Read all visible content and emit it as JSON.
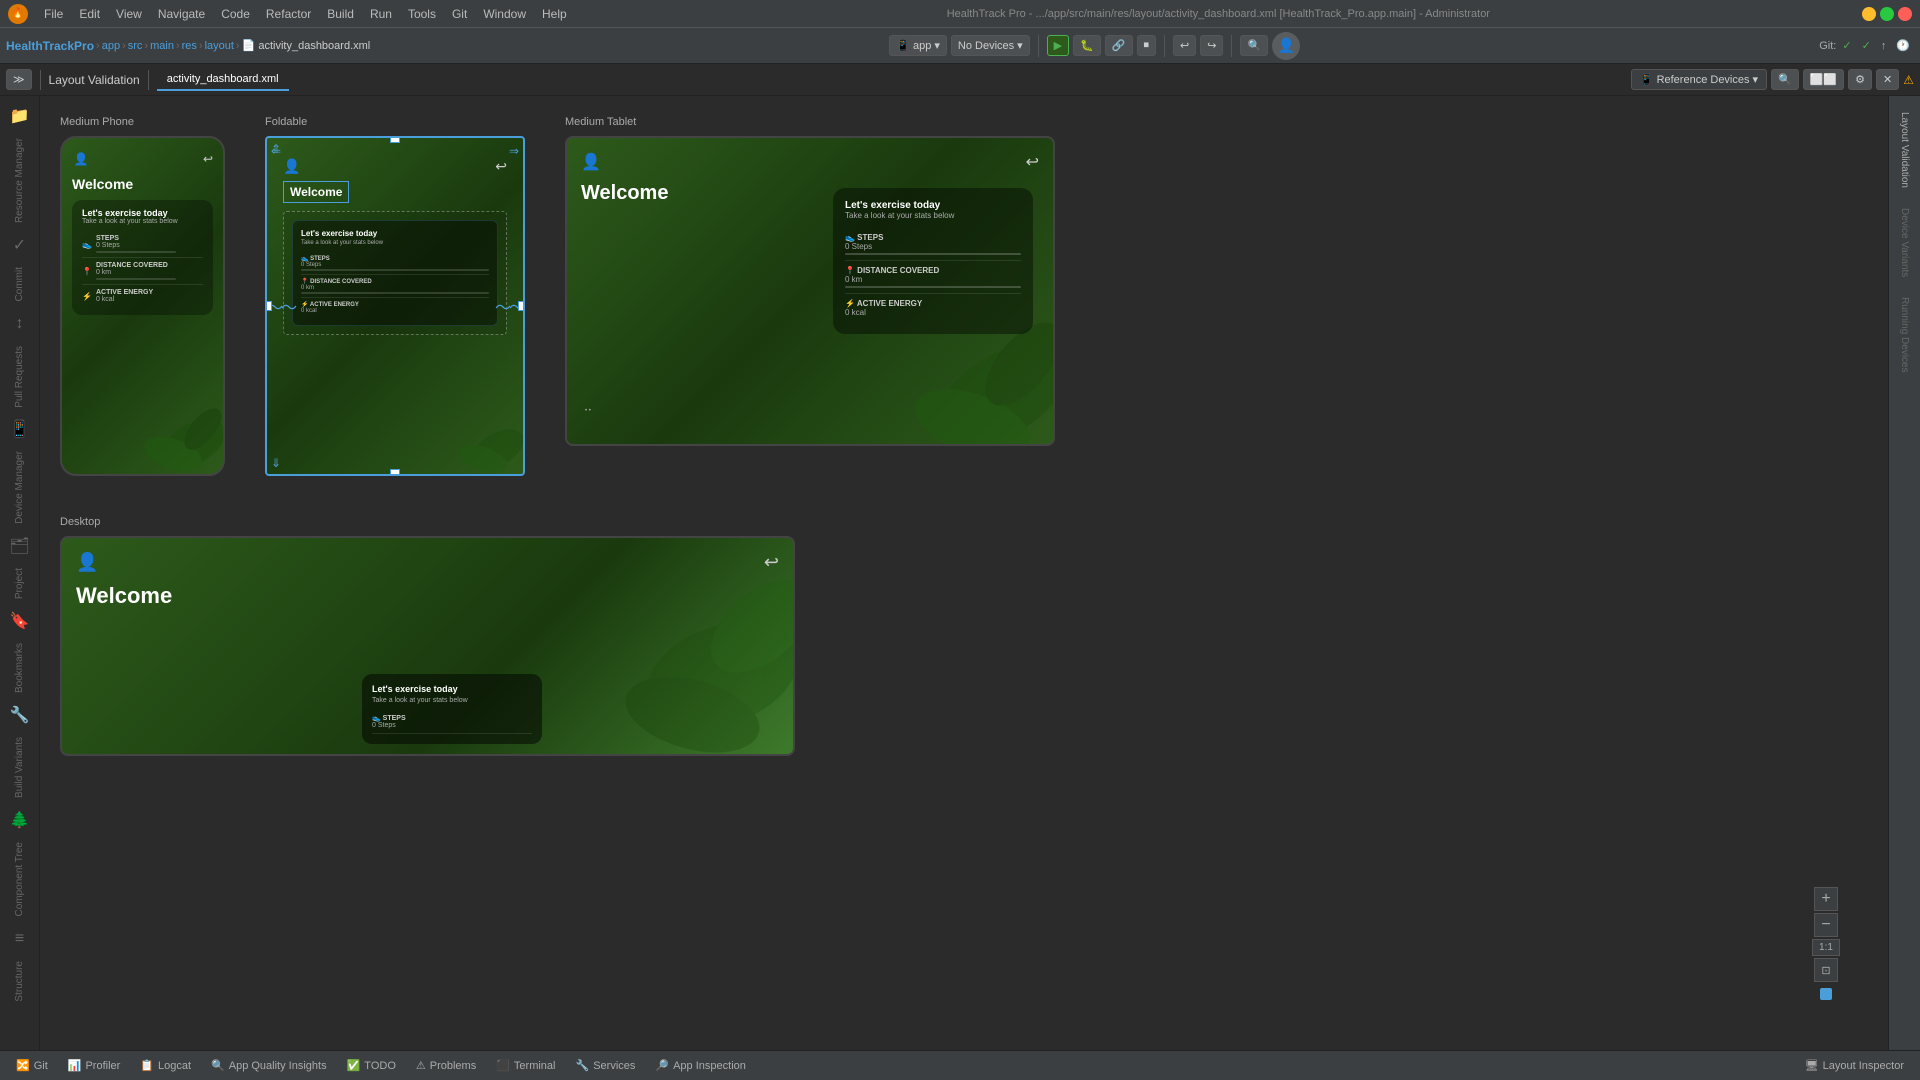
{
  "app": {
    "title": "HealthTrack Pro",
    "window_title": "HealthTrack Pro - .../app/src/main/res/layout/activity_dashboard.xml [HealthTrack_Pro.app.main] - Administrator"
  },
  "menu": {
    "items": [
      "File",
      "Edit",
      "View",
      "Navigate",
      "Code",
      "Refactor",
      "Build",
      "Run",
      "Tools",
      "Git",
      "Window",
      "Help"
    ]
  },
  "toolbar": {
    "project_name": "HealthTrackPro",
    "breadcrumb": [
      "app",
      "src",
      "main",
      "res",
      "layout"
    ],
    "file": "activity_dashboard.xml",
    "run_config": "app",
    "devices": "No Devices",
    "git_label": "Git:"
  },
  "second_toolbar": {
    "tab": "activity_dashboard.xml",
    "ref_devices": "Reference Devices",
    "panel_title": "Layout Validation"
  },
  "devices": {
    "medium_phone": {
      "label": "Medium Phone",
      "welcome": "Welcome",
      "card_title": "Let's exercise today",
      "card_subtitle": "Take a look at your stats below",
      "stats": [
        {
          "label": "STEPS",
          "value": "0 Steps"
        },
        {
          "label": "DISTANCE COVERED",
          "value": "0 km"
        },
        {
          "label": "ACTIVE ENERGY",
          "value": "0 kcal"
        }
      ]
    },
    "foldable": {
      "label": "Foldable",
      "welcome": "Welcome",
      "card_title": "Let's exercise today",
      "card_subtitle": "Take a look at your stats below",
      "stats": [
        {
          "label": "STEPS",
          "value": "0 Steps"
        },
        {
          "label": "DISTANCE COVERED",
          "value": "0 km"
        },
        {
          "label": "ACTIVE ENERGY",
          "value": "0 kcal"
        }
      ]
    },
    "medium_tablet": {
      "label": "Medium Tablet",
      "welcome": "Welcome",
      "card_title": "Let's exercise today",
      "card_subtitle": "Take a look at your stats below",
      "stats": [
        {
          "label": "STEPS",
          "value": "0 Steps"
        },
        {
          "label": "DISTANCE COVERED",
          "value": "0 km"
        },
        {
          "label": "ACTIVE ENERGY",
          "value": "0 kcal"
        }
      ]
    },
    "desktop": {
      "label": "Desktop",
      "welcome": "Welcome",
      "card_title": "Let's exercise today",
      "card_subtitle": "Take a look at your stats below",
      "stats": [
        {
          "label": "STEPS",
          "value": "0 Steps"
        }
      ]
    }
  },
  "zoom": {
    "ratio": "1:1",
    "plus": "+",
    "minus": "−"
  },
  "status_bar": {
    "items": [
      "Git",
      "Profiler",
      "Logcat",
      "App Quality Insights",
      "TODO",
      "Problems",
      "Terminal",
      "Services",
      "App Inspection"
    ],
    "right_item": "Layout Inspector"
  },
  "layout_validation_panel": "Layout Validation"
}
